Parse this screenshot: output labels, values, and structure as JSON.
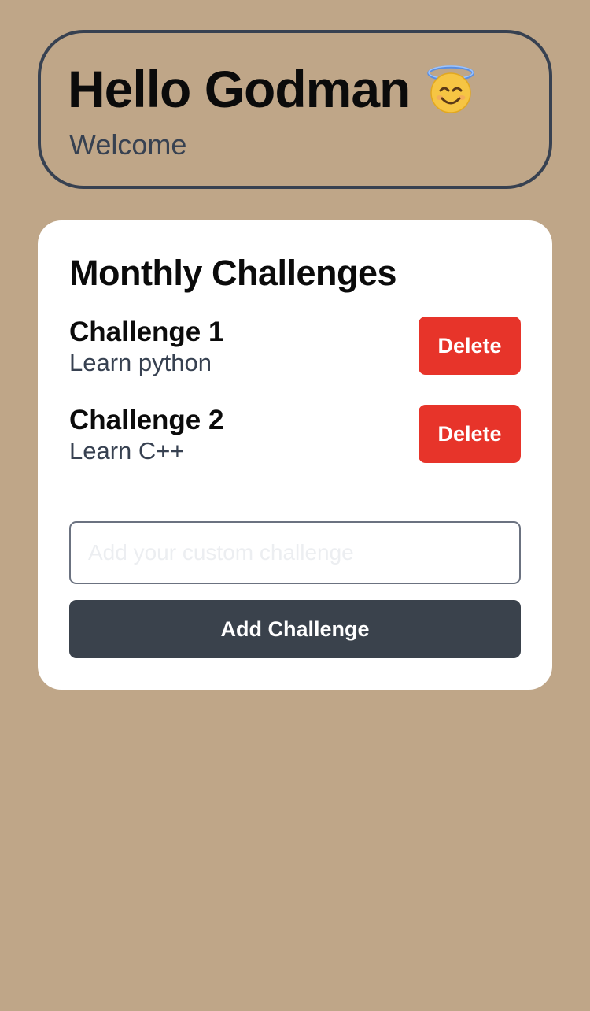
{
  "greeting": {
    "title": "Hello Godman",
    "emoji_icon": "smiling-face-with-halo-icon",
    "subtitle": "Welcome"
  },
  "challenges": {
    "title": "Monthly Challenges",
    "items": [
      {
        "name": "Challenge 1",
        "description": "Learn python",
        "delete_label": "Delete"
      },
      {
        "name": "Challenge 2",
        "description": "Learn C++",
        "delete_label": "Delete"
      }
    ],
    "input": {
      "value": "",
      "placeholder": "Add your custom challenge"
    },
    "add_label": "Add Challenge"
  },
  "colors": {
    "background": "#bfa688",
    "card": "#ffffff",
    "delete": "#e7342a",
    "primary_button": "#3a424c",
    "border": "#374151"
  }
}
